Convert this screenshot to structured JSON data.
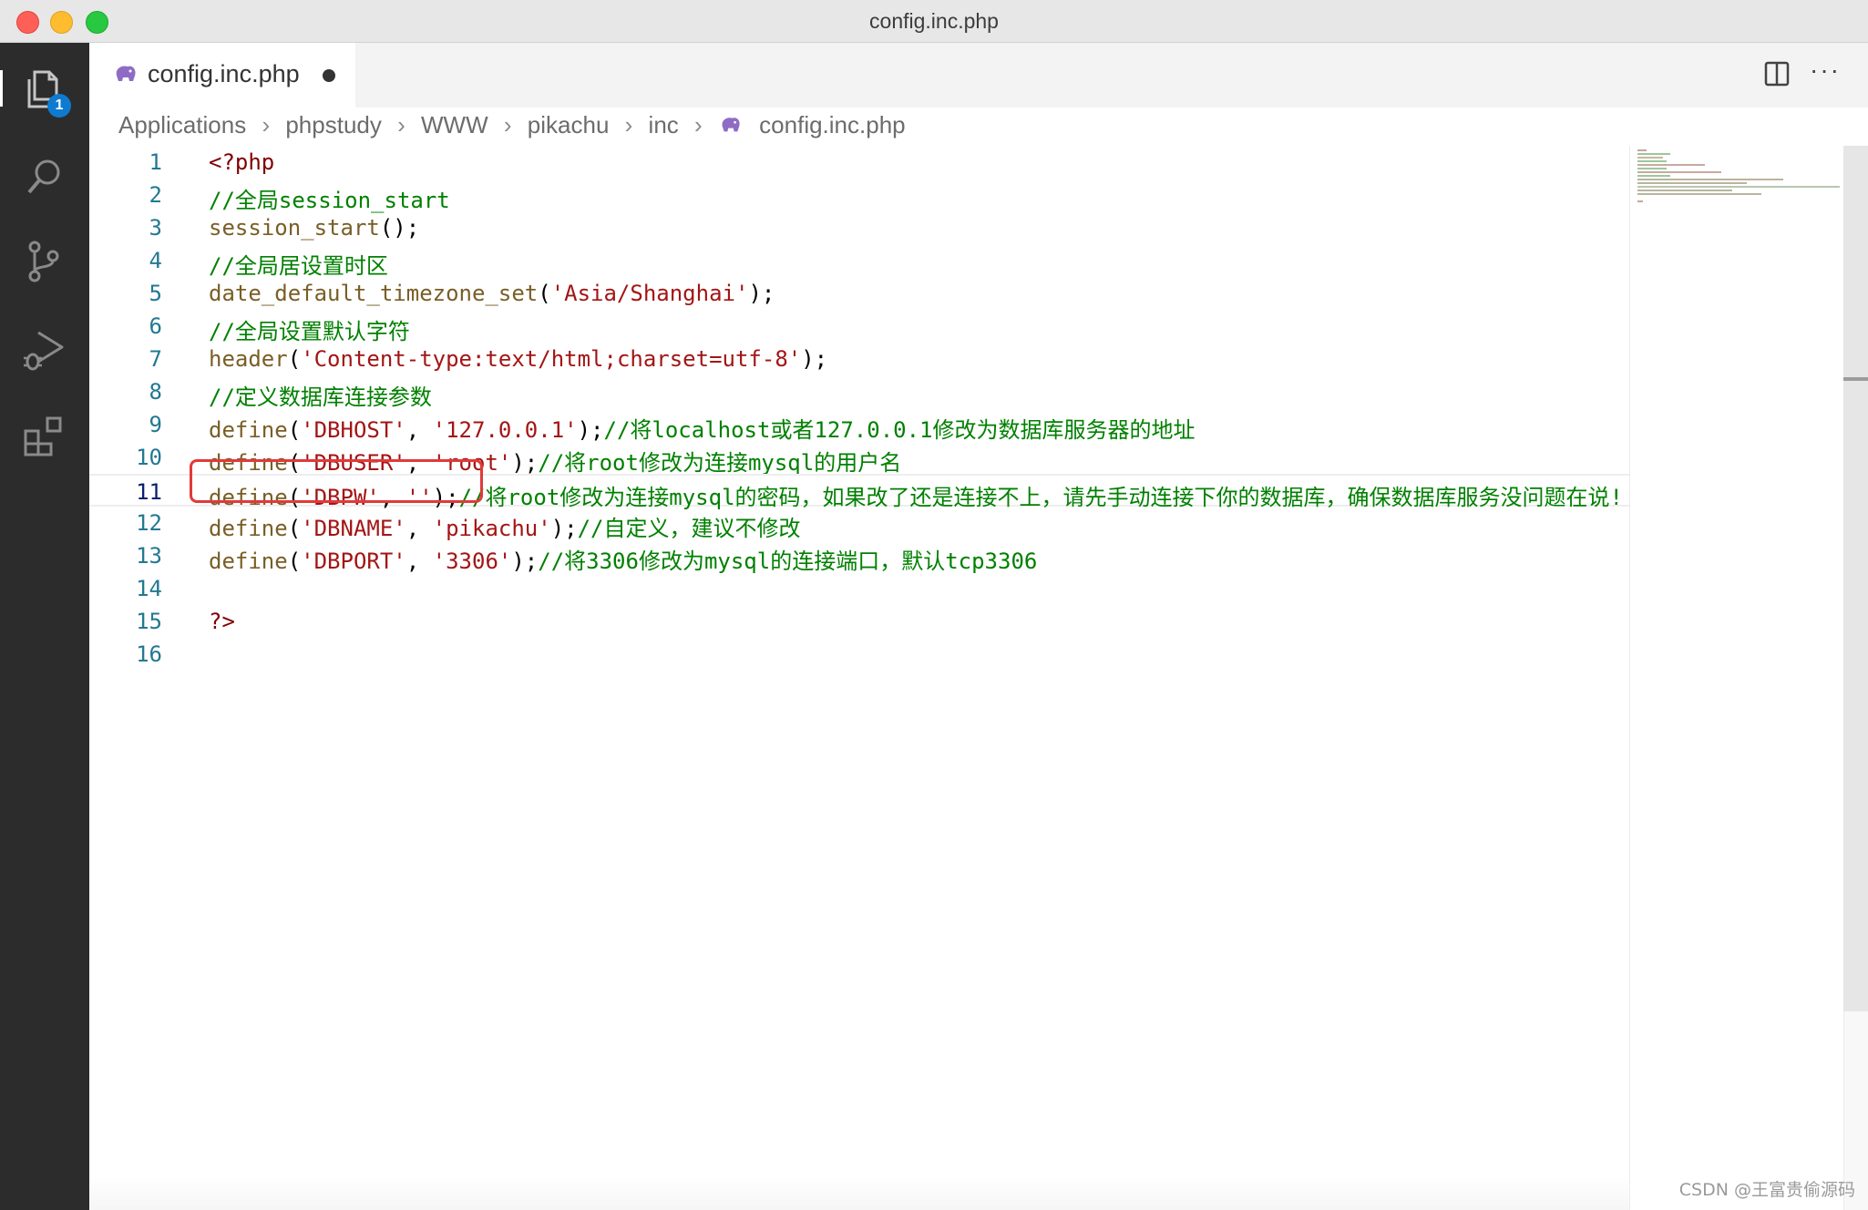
{
  "window": {
    "title": "config.inc.php"
  },
  "activity_bar": {
    "items": [
      {
        "name": "explorer",
        "icon": "files-icon",
        "badge": "1"
      },
      {
        "name": "search",
        "icon": "search-icon"
      },
      {
        "name": "source-control",
        "icon": "source-control-icon"
      },
      {
        "name": "run-debug",
        "icon": "run-debug-icon"
      },
      {
        "name": "extensions",
        "icon": "extensions-icon"
      }
    ]
  },
  "tab": {
    "label": "config.inc.php",
    "icon": "php-elephant-icon",
    "dirty": true
  },
  "editor_actions": {
    "split": "split-editor-icon",
    "more": "···"
  },
  "breadcrumb": [
    "Applications",
    "phpstudy",
    "WWW",
    "pikachu",
    "inc",
    "config.inc.php"
  ],
  "editor": {
    "current_line": 11,
    "lines": [
      {
        "n": "1"
      },
      {
        "n": "2"
      },
      {
        "n": "3"
      },
      {
        "n": "4"
      },
      {
        "n": "5"
      },
      {
        "n": "6"
      },
      {
        "n": "7"
      },
      {
        "n": "8"
      },
      {
        "n": "9"
      },
      {
        "n": "10"
      },
      {
        "n": "11"
      },
      {
        "n": "12"
      },
      {
        "n": "13"
      },
      {
        "n": "14"
      },
      {
        "n": "15"
      },
      {
        "n": "16"
      }
    ],
    "code": {
      "l1": {
        "a": "<?php"
      },
      "l2": {
        "a": "//全局session_start"
      },
      "l3": {
        "a": "session_start",
        "b": "();"
      },
      "l4": {
        "a": "//全局居设置时区"
      },
      "l5": {
        "a": "date_default_timezone_set",
        "b": "(",
        "c": "'Asia/Shanghai'",
        "d": ");"
      },
      "l6": {
        "a": "//全局设置默认字符"
      },
      "l7": {
        "a": "header",
        "b": "(",
        "c": "'Content-type:text/html;charset=utf-8'",
        "d": ");"
      },
      "l8": {
        "a": "//定义数据库连接参数"
      },
      "l9": {
        "a": "define",
        "b": "(",
        "c": "'DBHOST'",
        "d": ", ",
        "e": "'127.0.0.1'",
        "f": ");",
        "g": "//将localhost或者127.0.0.1修改为数据库服务器的地址"
      },
      "l10": {
        "a": "define",
        "b": "(",
        "c": "'DBUSER'",
        "d": ", ",
        "e": "'root'",
        "f": ");",
        "g": "//将root修改为连接mysql的用户名"
      },
      "l11": {
        "a": "define",
        "b": "(",
        "c": "'DBPW'",
        "d": ", ",
        "e": "''",
        "f": ");",
        "g": "//将root修改为连接mysql的密码，如果改了还是连接不上，请先手动连接下你的数据库，确保数据库服务没问题在说!"
      },
      "l12": {
        "a": "define",
        "b": "(",
        "c": "'DBNAME'",
        "d": ", ",
        "e": "'pikachu'",
        "f": ");",
        "g": "//自定义，建议不修改"
      },
      "l13": {
        "a": "define",
        "b": "(",
        "c": "'DBPORT'",
        "d": ", ",
        "e": "'3306'",
        "f": ");",
        "g": "//将3306修改为mysql的连接端口，默认tcp3306"
      },
      "l15": {
        "a": "?>"
      }
    }
  },
  "watermark": "CSDN @王富贵偷源码",
  "colors": {
    "keyword": "#800000",
    "function": "#795e26",
    "string": "#a31515",
    "comment": "#008000",
    "line_number": "#237893",
    "highlight_box": "#e03a3a"
  }
}
